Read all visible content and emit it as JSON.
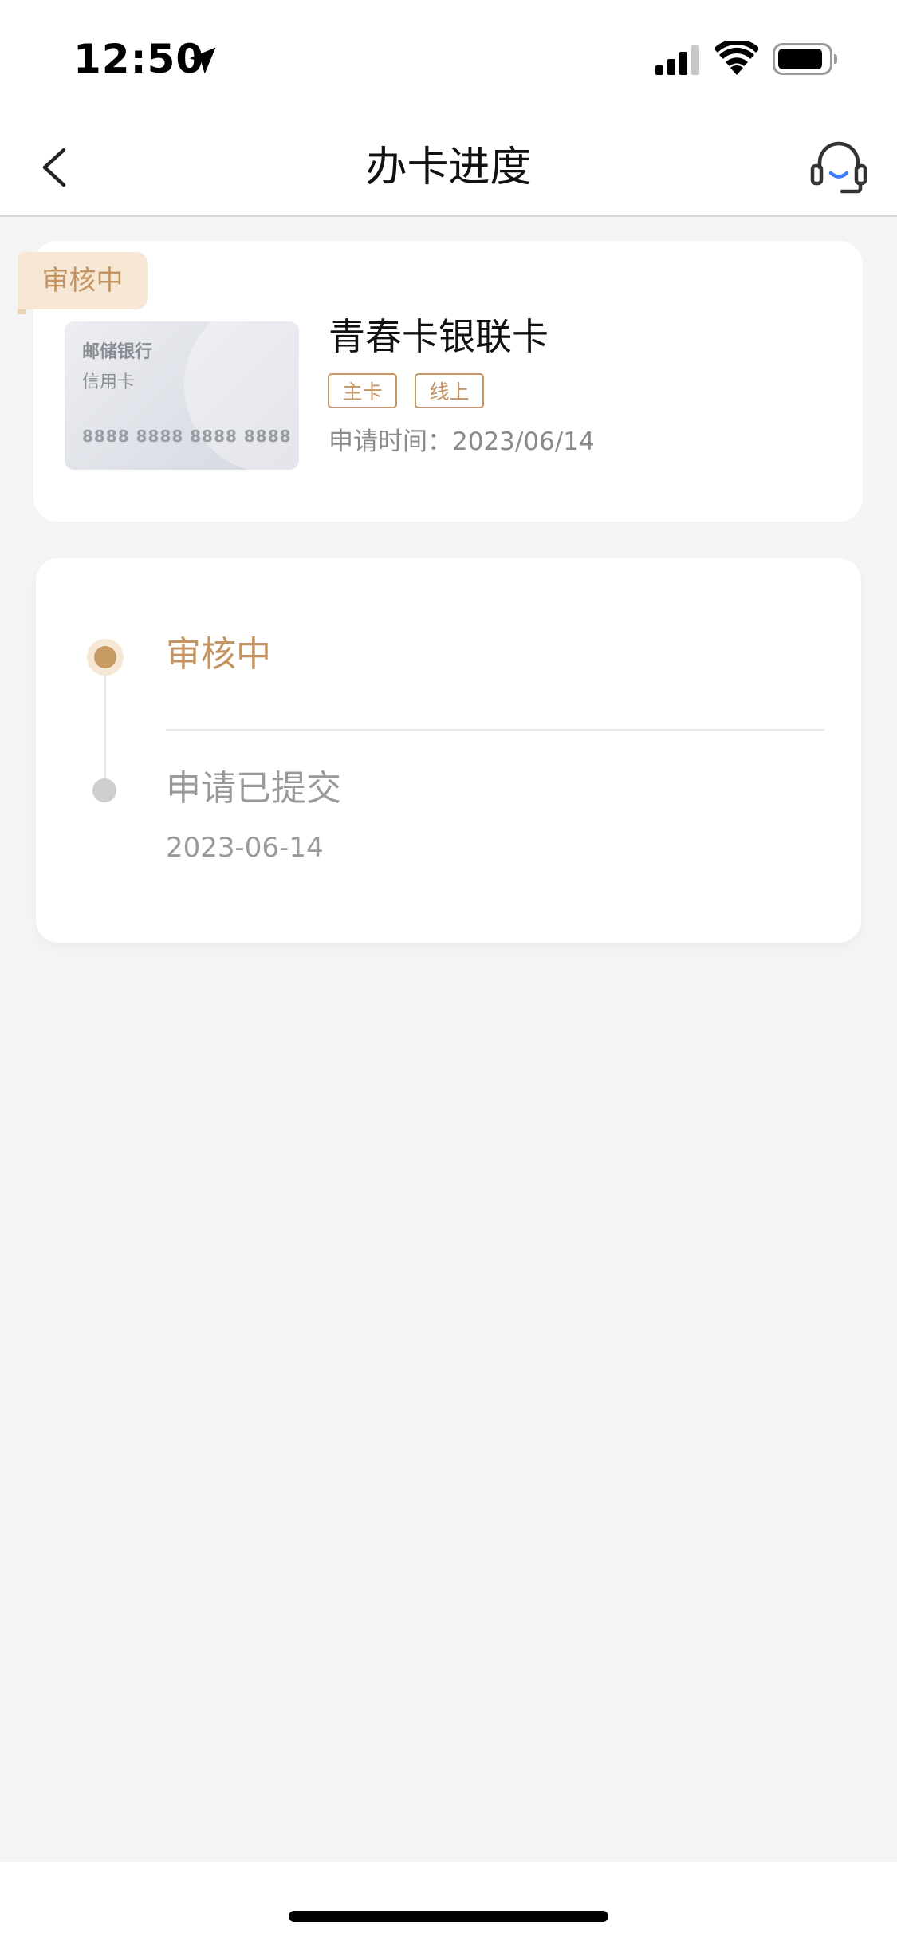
{
  "status_bar": {
    "time": "12:50",
    "icons": [
      "location-arrow-icon",
      "cellular-signal-icon",
      "wifi-icon",
      "battery-icon"
    ]
  },
  "nav": {
    "title": "办卡进度",
    "back_icon": "chevron-left-icon",
    "support_icon": "headset-icon"
  },
  "card_summary": {
    "status_badge": "审核中",
    "card_image": {
      "bank": "邮储银行",
      "type": "信用卡",
      "number": "8888 8888 8888 8888"
    },
    "card_name": "青春卡银联卡",
    "tags": [
      "主卡",
      "线上"
    ],
    "apply_time": "申请时间：2023/06/14"
  },
  "progress": {
    "steps": [
      {
        "label": "审核中",
        "state": "active"
      },
      {
        "label": "申请已提交",
        "date": "2023-06-14",
        "state": "done"
      }
    ]
  },
  "colors": {
    "accent": "#c49562",
    "badge_bg": "#f6e8d5",
    "page_bg": "#f4f4f5",
    "muted_text": "#9a9a9a"
  }
}
